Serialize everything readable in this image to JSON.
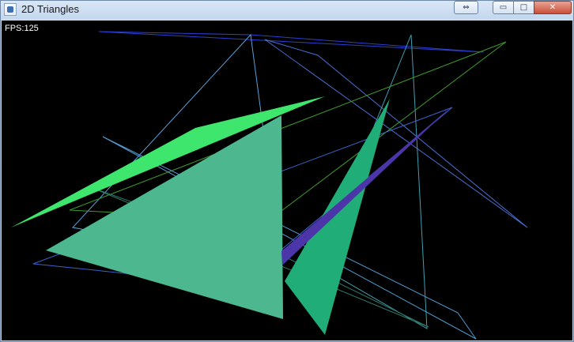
{
  "window": {
    "title": "2D Triangles",
    "resize_glyph": "⇔",
    "minimize_glyph": "▭",
    "maximize_glyph": "□",
    "close_glyph": "✕"
  },
  "canvas": {
    "background": "#000000",
    "fps_text": "FPS:125"
  }
}
